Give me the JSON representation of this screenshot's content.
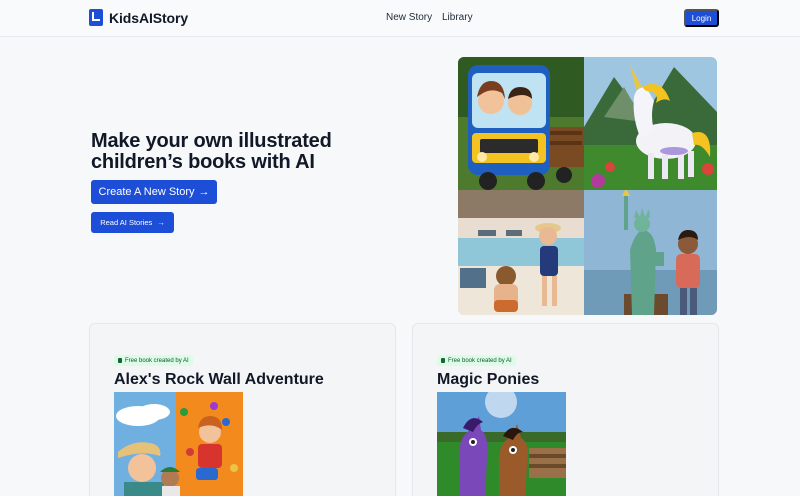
{
  "nav": {
    "brand": "KidsAIStory",
    "links": [
      "New Story",
      "Library"
    ],
    "login": "Login"
  },
  "hero": {
    "title": "Make your own illustrated children’s books with AI",
    "primary_cta": "Create A New Story",
    "secondary_cta": "Read AI Stories",
    "arrow": "→"
  },
  "books": [
    {
      "badge": "Free book created by AI",
      "title": "Alex's Rock Wall Adventure"
    },
    {
      "badge": "Free book created by AI",
      "title": "Magic Ponies"
    }
  ],
  "colors": {
    "accent": "#1d4ed8",
    "badge_bg": "#dcfce7",
    "badge_text": "#14532d"
  }
}
